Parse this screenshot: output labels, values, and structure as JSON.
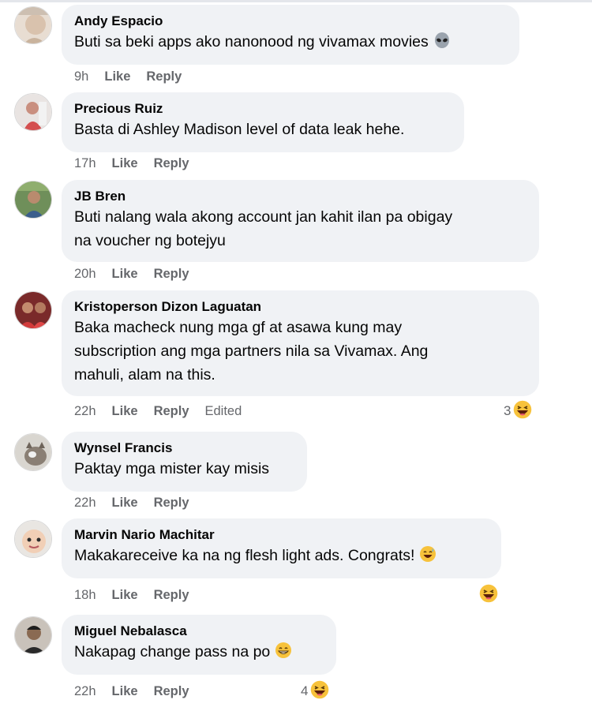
{
  "comments": [
    {
      "author": "Andy Espacio",
      "lines": [
        "Buti sa beki apps ako nanonood ng vivamax movies"
      ],
      "emoji": "alien-icon",
      "time": "9h",
      "like": "Like",
      "reply": "Reply"
    },
    {
      "author": "Precious Ruiz",
      "lines": [
        "Basta di Ashley Madison level of data leak hehe."
      ],
      "time": "17h",
      "like": "Like",
      "reply": "Reply"
    },
    {
      "author": "JB Bren",
      "lines": [
        "Buti nalang wala akong account jan kahit ilan pa obigay",
        "na voucher ng botejyu"
      ],
      "time": "20h",
      "like": "Like",
      "reply": "Reply"
    },
    {
      "author": "Kristoperson Dizon Laguatan",
      "lines": [
        "Baka macheck nung mga gf at asawa kung may",
        "subscription ang mga partners nila sa Vivamax. Ang",
        "mahuli, alam na this."
      ],
      "time": "22h",
      "like": "Like",
      "reply": "Reply",
      "edited": "Edited",
      "reaction_count": "3",
      "reaction": "haha-icon"
    },
    {
      "author": "Wynsel Francis",
      "lines": [
        "Paktay mga mister kay misis"
      ],
      "time": "22h",
      "like": "Like",
      "reply": "Reply"
    },
    {
      "author": "Marvin Nario Machitar",
      "lines": [
        "Makakareceive ka na ng flesh light ads. Congrats!"
      ],
      "emoji": "sweat-smile-icon",
      "time": "18h",
      "like": "Like",
      "reply": "Reply",
      "reaction": "haha-icon"
    },
    {
      "author": "Miguel Nebalasca",
      "lines": [
        "Nakapag change pass na po"
      ],
      "emoji": "grin-icon",
      "time": "22h",
      "like": "Like",
      "reply": "Reply",
      "reaction_count": "4",
      "reaction": "haha-icon"
    }
  ],
  "colors": {
    "bubble": "#f0f2f5",
    "meta": "#65676b",
    "text": "#050505"
  }
}
